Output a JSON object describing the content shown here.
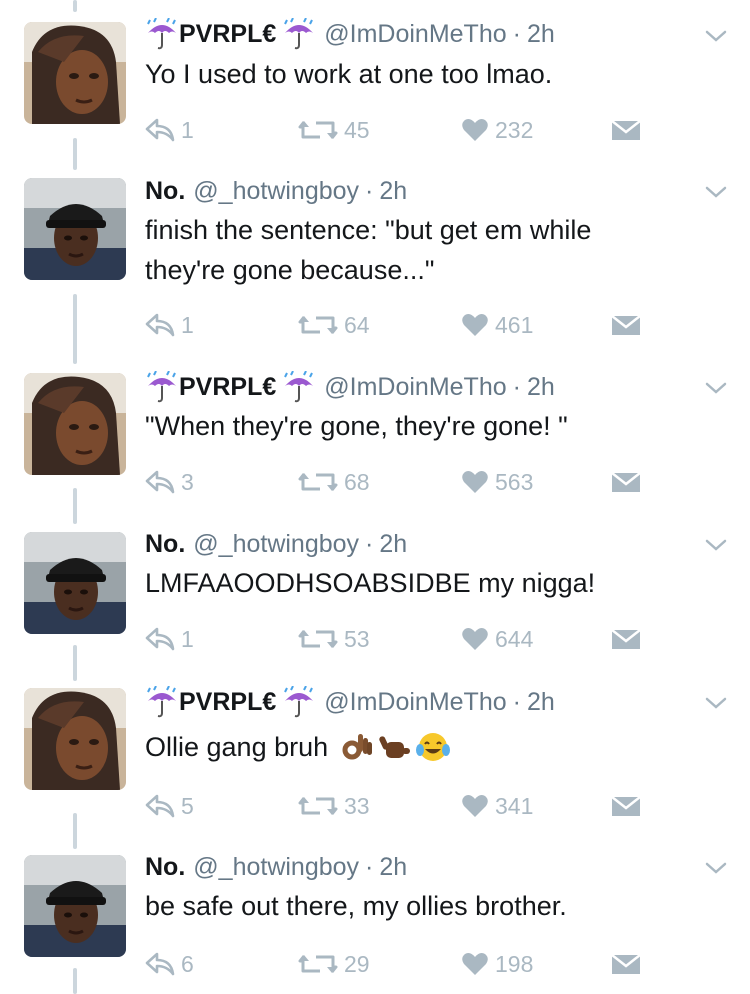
{
  "tweets": [
    {
      "author": "PVRPL€",
      "umbrella_emoji": "umbrella-with-rain-icon",
      "handle": "@ImDoinMeTho",
      "time": "2h",
      "text": "Yo I used to work at one too lmao.",
      "replies": "1",
      "retweets": "45",
      "likes": "232"
    },
    {
      "author": "No.",
      "handle": "@_hotwingboy",
      "time": "2h",
      "text_line1": "finish the sentence: \"but get em while",
      "text_line2": "they're gone because...\"",
      "replies": "1",
      "retweets": "64",
      "likes": "461"
    },
    {
      "author": "PVRPL€",
      "handle": "@ImDoinMeTho",
      "time": "2h",
      "text": "\"When they're gone, they're gone! \"",
      "replies": "3",
      "retweets": "68",
      "likes": "563"
    },
    {
      "author": "No.",
      "handle": "@_hotwingboy",
      "time": "2h",
      "text": "LMFAAOODHSOABSIDBE my nigga!",
      "replies": "1",
      "retweets": "53",
      "likes": "644"
    },
    {
      "author": "PVRPL€",
      "handle": "@ImDoinMeTho",
      "time": "2h",
      "text": "Ollie gang bruh",
      "emojis": [
        "ok-hand-icon",
        "call-me-hand-icon",
        "tears-of-joy-icon"
      ],
      "replies": "5",
      "retweets": "33",
      "likes": "341"
    },
    {
      "author": "No.",
      "handle": "@_hotwingboy",
      "time": "2h",
      "text": "be safe out there, my ollies brother.",
      "replies": "6",
      "retweets": "29",
      "likes": "198"
    }
  ],
  "separator": "·",
  "colors": {
    "text": "#14171a",
    "meta": "#657786",
    "action": "#aab8c2",
    "thread_line": "#ccd6dd"
  }
}
